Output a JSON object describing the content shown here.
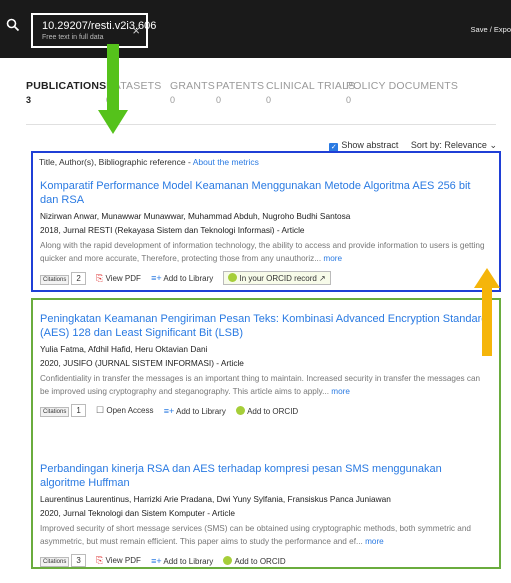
{
  "search": {
    "query": "10.29207/resti.v2i3.606",
    "scope": "Free text in full data",
    "clear_icon": "×"
  },
  "header": {
    "save_export": "Save / Expo"
  },
  "tabs": [
    {
      "label": "PUBLICATIONS",
      "count": "3"
    },
    {
      "label": "DATASETS",
      "count": "0"
    },
    {
      "label": "GRANTS",
      "count": "0"
    },
    {
      "label": "PATENTS",
      "count": "0"
    },
    {
      "label": "CLINICAL TRIALS",
      "count": "0"
    },
    {
      "label": "POLICY DOCUMENTS",
      "count": "0"
    }
  ],
  "controls": {
    "show_abstract": "Show abstract",
    "sort_by": "Sort by: Relevance"
  },
  "meta_line": {
    "text": "Title, Author(s), Bibliographic reference - ",
    "link": "About the metrics"
  },
  "articles": [
    {
      "title": "Komparatif Performance Model Keamanan Menggunakan Metode Algoritma AES 256 bit dan RSA",
      "authors": "Nizirwan Anwar, Munawwar Munawwar, Muhammad Abduh, Nugroho Budhi Santosa",
      "publication": "2018, Jurnal RESTI (Rekayasa Sistem dan Teknologi Informasi) - Article",
      "abstract": "Along with the rapid development of information technology, the ability to access and provide information to users is getting quicker and more accurate, Therefore, protecting those from any unauthoriz...",
      "more": "more",
      "citations_label": "Citations",
      "citations": "2",
      "action1": "View PDF",
      "action2": "Add to Library",
      "action3": "In your ORCID record ↗"
    },
    {
      "title": "Peningkatan Keamanan Pengiriman Pesan Teks: Kombinasi Advanced Encryption Standard (AES) 128 dan Least Significant Bit (LSB)",
      "authors": "Yulia Fatma, Afdhil Hafid, Heru Oktavian Dani",
      "publication": "2020, JUSIFO (JURNAL SISTEM INFORMASI) - Article",
      "abstract": "Confidentiality in transfer the messages is an important thing to maintain. Increased security in transfer the messages can be improved using cryptography and steganography. This article aims to apply...",
      "more": "more",
      "citations_label": "Citations",
      "citations": "1",
      "action1": "Open Access",
      "action2": "Add to Library",
      "action3": "Add to ORCID"
    },
    {
      "title": "Perbandingan kinerja RSA dan AES terhadap kompresi pesan SMS menggunakan algoritme Huffman",
      "authors": "Laurentinus Laurentinus, Harrizki Arie Pradana, Dwi Yuny Sylfania, Fransiskus Panca Juniawan",
      "publication": "2020, Jurnal Teknologi dan Sistem Komputer - Article",
      "abstract": "Improved security of short message services (SMS) can be obtained using cryptographic methods, both symmetric and asymmetric, but must remain efficient. This paper aims to study the performance and ef...",
      "more": "more",
      "citations_label": "Citations",
      "citations": "3",
      "action1": "View PDF",
      "action2": "Add to Library",
      "action3": "Add to ORCID"
    }
  ],
  "colors": {
    "highlight_blue": "#1f3fd6",
    "highlight_green": "#6aac3e",
    "arrow_green": "#55c21b",
    "arrow_orange": "#f5b50a",
    "link": "#2a7ae2"
  }
}
